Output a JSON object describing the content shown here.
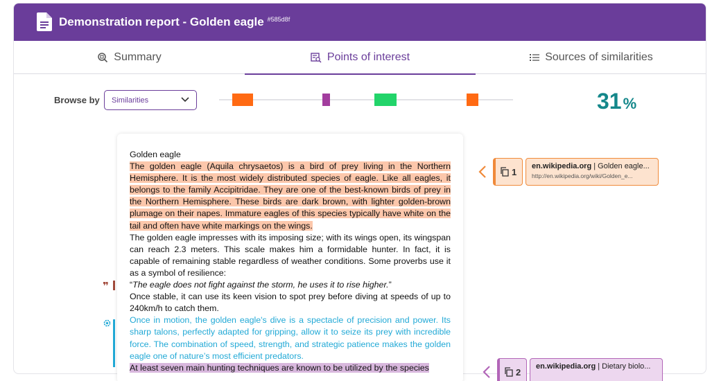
{
  "header": {
    "title": "Demonstration report - Golden eagle",
    "hash": "#585d8f"
  },
  "tabs": [
    {
      "label": "Summary",
      "icon": "summary-icon"
    },
    {
      "label": "Points of interest",
      "icon": "points-of-interest-icon",
      "active": true
    },
    {
      "label": "Sources of similarities",
      "icon": "list-icon"
    }
  ],
  "browse": {
    "label": "Browse by",
    "selected": "Similarities"
  },
  "timeline": {
    "marks": [
      {
        "type": "orange",
        "color": "#ff6a13"
      },
      {
        "type": "purple",
        "color": "#a23d9e"
      },
      {
        "type": "green",
        "color": "#22d46a"
      },
      {
        "type": "orange",
        "color": "#ff6a13"
      }
    ]
  },
  "score": {
    "value": "31",
    "unit": "%",
    "color": "#14878a"
  },
  "document": {
    "heading": "Golden eagle",
    "p1": "The golden eagle (Aquila chrysaetos) is a bird of prey living in the Northern Hemisphere. It is the most widely distributed species of eagle. Like all eagles, it belongs to the family Accipitridae. They are one of the best-known birds of prey in the Northern Hemisphere. These birds are dark brown, with lighter golden-brown plumage on their napes. Immature eagles of this species typically have white on the tail and often have white markings on the wings.",
    "p2": "The golden eagle impresses with its imposing size; with its wings open, its wingspan can reach 2.3 meters. This scale makes him a formidable hunter. In fact, it is capable of remaining stable regardless of weather conditions. Some proverbs use it as a symbol of resilience:",
    "quote_open": "“",
    "quote": "The eagle does not fight against the storm, he uses it to rise higher.",
    "quote_close": "”",
    "p3": "Once stable, it can use its keen vision to spot prey before diving at speeds of up to 240km/h to catch them.",
    "p4": "Once in motion, the golden eagle's dive is a spectacle of precision and power. Its sharp talons, perfectly adapted for gripping, allow it to seize its prey with incredible force. The combination of speed, strength, and strategic patience makes the golden eagle one of nature’s most efficient predators.",
    "p5": "At least seven main hunting techniques are known to be utilized by the species"
  },
  "sources": [
    {
      "number": "1",
      "domain": "en.wikipedia.org",
      "title": "| Golden eagle...",
      "url": "http://en.wikipedia.org/wiki/Golden_e...",
      "color": "#f08a3a",
      "bg": "#fde3cf"
    },
    {
      "number": "2",
      "domain": "en.wikipedia.org",
      "title": "| Dietary biolo...",
      "url": "",
      "color": "#b266b8",
      "bg": "#edd7ef"
    }
  ]
}
